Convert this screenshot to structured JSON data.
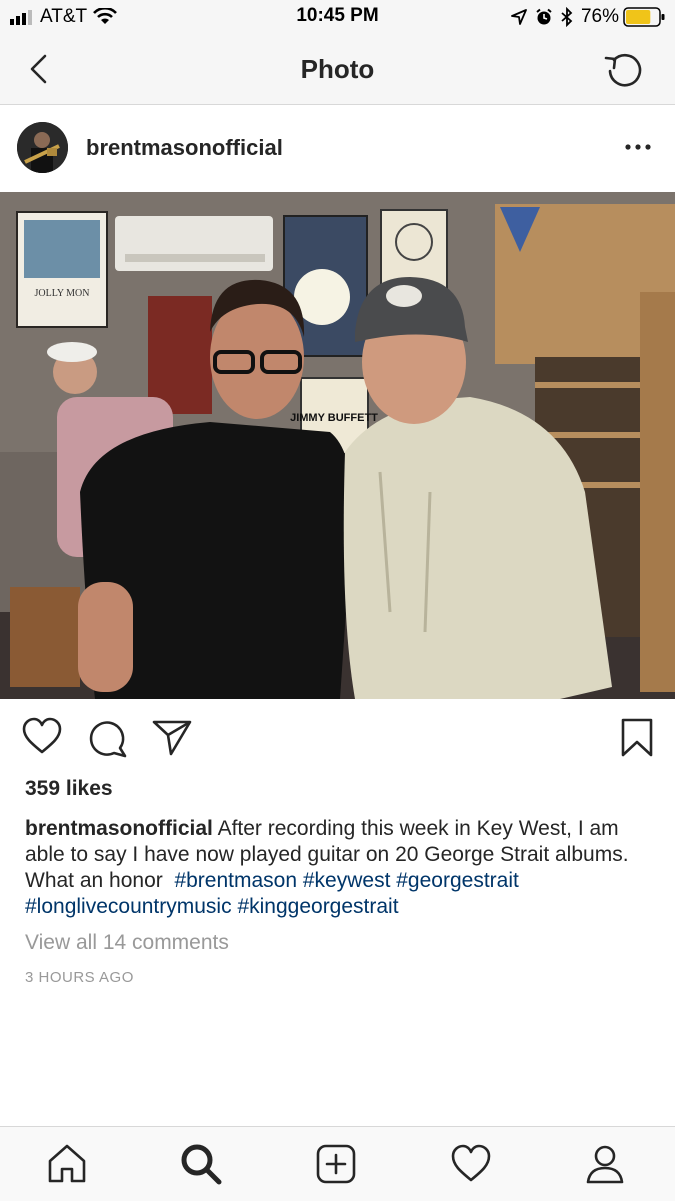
{
  "status_bar": {
    "carrier": "AT&T",
    "time": "10:45 PM",
    "battery": "76%",
    "battery_level": 0.76,
    "icons": [
      "signal-icon",
      "wifi-icon",
      "location-icon",
      "alarm-icon",
      "bluetooth-icon",
      "battery-icon"
    ]
  },
  "nav": {
    "title": "Photo"
  },
  "post": {
    "username": "brentmasonofficial",
    "likes": "359 likes",
    "caption": {
      "username": "brentmasonofficial",
      "text": "After recording this week in Key West, I am able to say I have now played guitar on 20 George Strait albums. What an honor",
      "hashtags": [
        "#brentmason",
        "#keywest",
        "#georgestrait",
        "#longlivecountrymusic",
        "#kinggeorgestrait"
      ]
    },
    "comments_link": "View all 14 comments",
    "timestamp": "3 HOURS AGO"
  },
  "photo": {
    "poster_1": "JOLLY MON",
    "poster_2": "JIMMY BUFFETT"
  },
  "colors": {
    "hashtag": "#003569",
    "secondary_text": "#999999",
    "text": "#262626",
    "bar_bg": "#f6f6f6"
  }
}
